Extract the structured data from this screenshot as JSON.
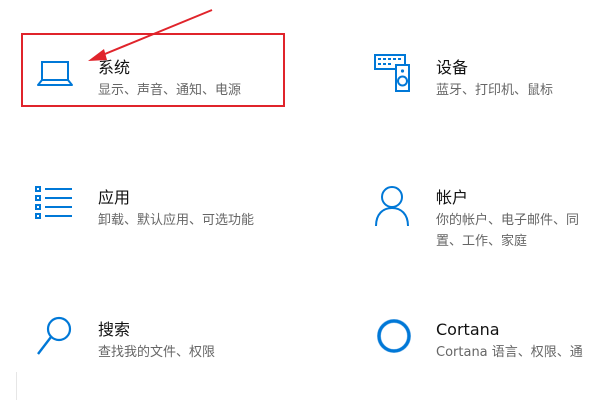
{
  "colors": {
    "accent": "#0078d7",
    "annotation": "#e0242b",
    "title": "#111111",
    "description": "#666666"
  },
  "tiles": {
    "system": {
      "title": "系统",
      "description": "显示、声音、通知、电源",
      "icon": "laptop-icon"
    },
    "devices": {
      "title": "设备",
      "description": "蓝牙、打印机、鼠标",
      "icon": "keyboard-speaker-icon"
    },
    "apps": {
      "title": "应用",
      "description": "卸载、默认应用、可选功能",
      "icon": "app-list-icon"
    },
    "accounts": {
      "title": "帐户",
      "description_line1": "你的帐户、电子邮件、同",
      "description_line2": "置、工作、家庭",
      "icon": "person-icon"
    },
    "search": {
      "title": "搜索",
      "description": "查找我的文件、权限",
      "icon": "magnifier-icon"
    },
    "cortana": {
      "title": "Cortana",
      "description": "Cortana 语言、权限、通",
      "icon": "cortana-ring-icon"
    }
  },
  "annotation": {
    "box": "highlight-rectangle",
    "arrow": "red-arrow"
  }
}
